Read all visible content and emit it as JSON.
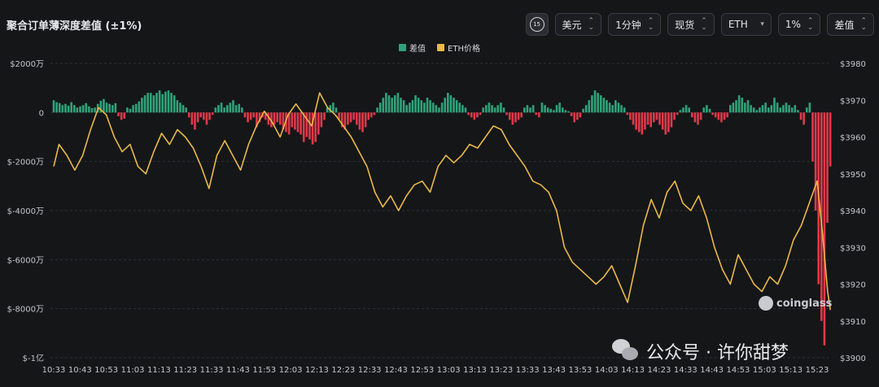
{
  "title": "聚合订单薄深度差值 (±1%)",
  "controls": {
    "interval_icon_label": "15",
    "currency": "美元",
    "timeframe": "1分钟",
    "market": "现货",
    "asset": "ETH",
    "range": "1%",
    "metric": "差值"
  },
  "legend": [
    {
      "label": "差值",
      "color": "#2fa37a"
    },
    {
      "label": "ETH价格",
      "color": "#e9b949"
    }
  ],
  "watermark": "coinglass",
  "wechat_text": "公众号 · 许你甜梦",
  "colors": {
    "pos_bar": "#2fa37a",
    "neg_bar": "#e0394a",
    "price_line": "#e9b949",
    "grid": "#2e3035"
  },
  "chart_data": {
    "type": "bar",
    "title": "聚合订单薄深度差值 (±1%)",
    "x_ticks": [
      "10:33",
      "10:43",
      "10:53",
      "11:03",
      "11:13",
      "11:23",
      "11:33",
      "11:43",
      "11:53",
      "12:03",
      "12:13",
      "12:23",
      "12:33",
      "12:43",
      "12:53",
      "13:03",
      "13:13",
      "13:23",
      "13:33",
      "13:43",
      "13:53",
      "14:03",
      "14:13",
      "14:23",
      "14:33",
      "14:43",
      "14:53",
      "15:03",
      "15:13",
      "15:23"
    ],
    "y_left_ticks": [
      "$2000万",
      "0",
      "$-2000万",
      "$-4000万",
      "$-6000万",
      "$-8000万",
      "$-1亿"
    ],
    "y_left_range": [
      -10000,
      2000
    ],
    "y_left_unit": "万",
    "y_right_ticks": [
      "$3980",
      "$3970",
      "$3960",
      "$3950",
      "$3940",
      "$3930",
      "$3920",
      "$3910",
      "$3900"
    ],
    "y_right_range": [
      3900,
      3980
    ],
    "grid": true,
    "legend_position": "top-center",
    "series": [
      {
        "name": "差值",
        "type": "bar",
        "x_range": [
          "10:33",
          "15:28"
        ],
        "values": [
          500,
          420,
          380,
          300,
          350,
          280,
          420,
          300,
          200,
          250,
          300,
          380,
          250,
          180,
          200,
          350,
          480,
          550,
          400,
          350,
          300,
          380,
          -150,
          -300,
          -250,
          200,
          150,
          300,
          350,
          450,
          600,
          700,
          800,
          800,
          700,
          800,
          900,
          750,
          850,
          900,
          800,
          700,
          500,
          400,
          300,
          200,
          -200,
          -500,
          -700,
          -400,
          -200,
          -300,
          -500,
          -300,
          -100,
          200,
          300,
          400,
          200,
          300,
          400,
          500,
          300,
          350,
          200,
          -200,
          -400,
          -300,
          -200,
          -600,
          -400,
          -200,
          -300,
          -500,
          -600,
          -500,
          -400,
          -500,
          -700,
          -800,
          -900,
          -600,
          -700,
          -800,
          -900,
          -1200,
          -1000,
          -1100,
          -1300,
          -1200,
          -900,
          -600,
          -300,
          200,
          300,
          400,
          200,
          -300,
          -600,
          -700,
          -500,
          -400,
          -300,
          -500,
          -700,
          -800,
          -600,
          -300,
          -200,
          -100,
          200,
          400,
          600,
          800,
          700,
          600,
          700,
          800,
          600,
          500,
          300,
          400,
          500,
          700,
          600,
          500,
          400,
          600,
          500,
          400,
          300,
          200,
          400,
          600,
          800,
          700,
          600,
          500,
          400,
          300,
          200,
          -100,
          -200,
          -300,
          -200,
          -100,
          200,
          300,
          400,
          300,
          200,
          300,
          400,
          200,
          -100,
          -300,
          -500,
          -400,
          -300,
          -200,
          200,
          300,
          200,
          300,
          -100,
          -200,
          400,
          300,
          200,
          150,
          100,
          300,
          400,
          200,
          100,
          50,
          -150,
          -400,
          -300,
          -200,
          150,
          300,
          500,
          700,
          900,
          800,
          700,
          600,
          500,
          400,
          300,
          500,
          400,
          300,
          200,
          -100,
          -300,
          -500,
          -700,
          -800,
          -900,
          -700,
          -500,
          -600,
          -400,
          -300,
          -500,
          -700,
          -900,
          -800,
          -600,
          -300,
          -100,
          100,
          200,
          300,
          200,
          -200,
          -400,
          -500,
          -300,
          200,
          300,
          150,
          -100,
          -200,
          -300,
          -400,
          -300,
          -200,
          300,
          400,
          500,
          700,
          600,
          400,
          500,
          300,
          200,
          100,
          200,
          300,
          400,
          200,
          300,
          600,
          400,
          200,
          300,
          400,
          300,
          200,
          300,
          100,
          -300,
          -500,
          200,
          400,
          -2000,
          -4000,
          -7000,
          -8500,
          -9500,
          -4500,
          -2200
        ]
      },
      {
        "name": "ETH价格",
        "type": "line",
        "points": [
          [
            "10:33",
            3952
          ],
          [
            "10:35",
            3958
          ],
          [
            "10:38",
            3955
          ],
          [
            "10:41",
            3951
          ],
          [
            "10:44",
            3955
          ],
          [
            "10:47",
            3962
          ],
          [
            "10:50",
            3968
          ],
          [
            "10:53",
            3966
          ],
          [
            "10:56",
            3960
          ],
          [
            "10:59",
            3956
          ],
          [
            "11:02",
            3958
          ],
          [
            "11:05",
            3952
          ],
          [
            "11:08",
            3950
          ],
          [
            "11:11",
            3956
          ],
          [
            "11:14",
            3961
          ],
          [
            "11:17",
            3958
          ],
          [
            "11:20",
            3962
          ],
          [
            "11:23",
            3960
          ],
          [
            "11:26",
            3957
          ],
          [
            "11:29",
            3952
          ],
          [
            "11:32",
            3946
          ],
          [
            "11:35",
            3955
          ],
          [
            "11:38",
            3959
          ],
          [
            "11:41",
            3955
          ],
          [
            "11:44",
            3951
          ],
          [
            "11:47",
            3958
          ],
          [
            "11:50",
            3963
          ],
          [
            "11:53",
            3967
          ],
          [
            "11:56",
            3964
          ],
          [
            "11:59",
            3960
          ],
          [
            "12:02",
            3966
          ],
          [
            "12:05",
            3969
          ],
          [
            "12:08",
            3966
          ],
          [
            "12:11",
            3963
          ],
          [
            "12:14",
            3972
          ],
          [
            "12:17",
            3968
          ],
          [
            "12:20",
            3966
          ],
          [
            "12:23",
            3963
          ],
          [
            "12:26",
            3960
          ],
          [
            "12:29",
            3956
          ],
          [
            "12:32",
            3952
          ],
          [
            "12:35",
            3945
          ],
          [
            "12:38",
            3941
          ],
          [
            "12:41",
            3944
          ],
          [
            "12:44",
            3940
          ],
          [
            "12:47",
            3944
          ],
          [
            "12:50",
            3947
          ],
          [
            "12:53",
            3948
          ],
          [
            "12:56",
            3945
          ],
          [
            "12:59",
            3952
          ],
          [
            "13:02",
            3955
          ],
          [
            "13:05",
            3953
          ],
          [
            "13:08",
            3955
          ],
          [
            "13:11",
            3958
          ],
          [
            "13:14",
            3957
          ],
          [
            "13:17",
            3960
          ],
          [
            "13:20",
            3963
          ],
          [
            "13:23",
            3962
          ],
          [
            "13:26",
            3958
          ],
          [
            "13:29",
            3955
          ],
          [
            "13:32",
            3952
          ],
          [
            "13:35",
            3948
          ],
          [
            "13:38",
            3947
          ],
          [
            "13:41",
            3945
          ],
          [
            "13:44",
            3940
          ],
          [
            "13:47",
            3930
          ],
          [
            "13:50",
            3926
          ],
          [
            "13:53",
            3924
          ],
          [
            "13:56",
            3922
          ],
          [
            "13:59",
            3920
          ],
          [
            "14:02",
            3922
          ],
          [
            "14:05",
            3925
          ],
          [
            "14:08",
            3920
          ],
          [
            "14:11",
            3915
          ],
          [
            "14:14",
            3925
          ],
          [
            "14:17",
            3936
          ],
          [
            "14:20",
            3943
          ],
          [
            "14:23",
            3938
          ],
          [
            "14:26",
            3945
          ],
          [
            "14:29",
            3948
          ],
          [
            "14:32",
            3942
          ],
          [
            "14:35",
            3940
          ],
          [
            "14:38",
            3944
          ],
          [
            "14:41",
            3938
          ],
          [
            "14:44",
            3930
          ],
          [
            "14:47",
            3924
          ],
          [
            "14:50",
            3920
          ],
          [
            "14:53",
            3928
          ],
          [
            "14:56",
            3924
          ],
          [
            "14:59",
            3920
          ],
          [
            "15:02",
            3918
          ],
          [
            "15:05",
            3922
          ],
          [
            "15:08",
            3920
          ],
          [
            "15:11",
            3925
          ],
          [
            "15:14",
            3932
          ],
          [
            "15:17",
            3936
          ],
          [
            "15:20",
            3942
          ],
          [
            "15:23",
            3948
          ],
          [
            "15:25",
            3934
          ],
          [
            "15:26",
            3926
          ],
          [
            "15:27",
            3918
          ],
          [
            "15:28",
            3913
          ]
        ]
      }
    ]
  }
}
